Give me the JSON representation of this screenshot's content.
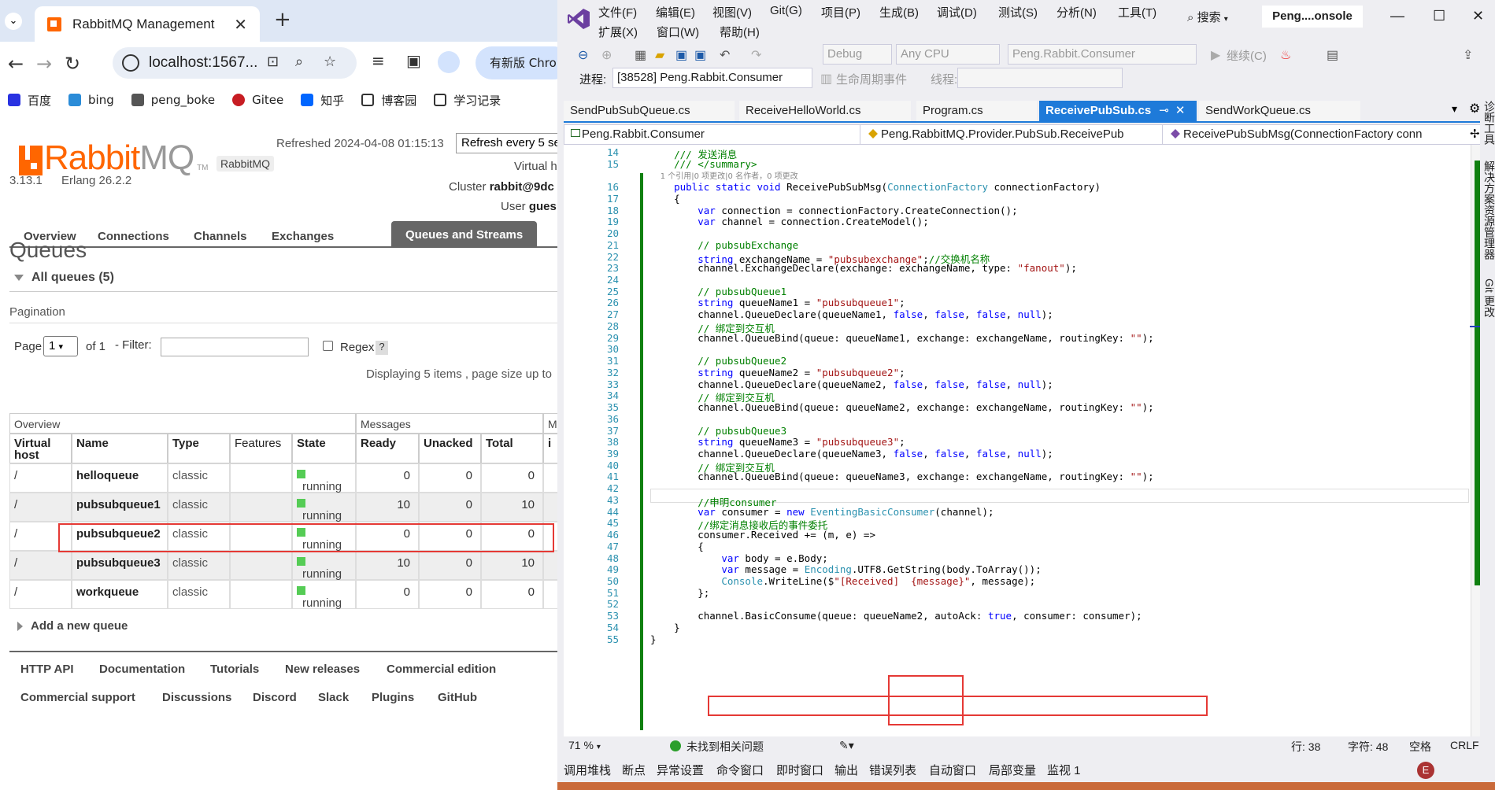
{
  "browser": {
    "tab_title": "RabbitMQ Management",
    "url": "localhost:1567...",
    "update_button": "有新版 Chro",
    "bookmarks": [
      "百度",
      "bing",
      "peng_boke",
      "Gitee",
      "知乎",
      "博客园",
      "学习记录"
    ]
  },
  "rabbitmq": {
    "logo_rabbit": "Rabbit",
    "logo_mq": "MQ",
    "logo_tm": "TM",
    "version": "3.13.1",
    "erlang": "Erlang 26.2.2",
    "cluster_badge": "RabbitMQ",
    "refreshed": "Refreshed 2024-04-08 01:15:13",
    "refresh_select": "Refresh every 5 se",
    "virtual_host": "Virtual h",
    "cluster_prefix": "Cluster ",
    "cluster_name": "rabbit@9dc",
    "user_prefix": "User ",
    "user_name": "gues",
    "nav": [
      "Overview",
      "Connections",
      "Channels",
      "Exchanges",
      "Queues and Streams"
    ],
    "nav_active": "Queues and Streams",
    "page_heading": "Queues",
    "all_queues": "All queues (5)",
    "pagination_label": "Pagination",
    "page_label": "Page",
    "page_value": "1",
    "of_label": "of 1",
    "filter_label": "- Filter:",
    "regex_label": "Regex",
    "regex_help": "?",
    "displaying": "Displaying 5 items , page size up to",
    "table": {
      "group_overview": "Overview",
      "group_messages": "Messages",
      "group_more": "M",
      "headers": [
        "Virtual host",
        "Name",
        "Type",
        "Features",
        "State",
        "Ready",
        "Unacked",
        "Total",
        "i"
      ],
      "rows": [
        {
          "vhost": "/",
          "name": "helloqueue",
          "type": "classic",
          "state": "running",
          "ready": "0",
          "unacked": "0",
          "total": "0"
        },
        {
          "vhost": "/",
          "name": "pubsubqueue1",
          "type": "classic",
          "state": "running",
          "ready": "10",
          "unacked": "0",
          "total": "10"
        },
        {
          "vhost": "/",
          "name": "pubsubqueue2",
          "type": "classic",
          "state": "running",
          "ready": "0",
          "unacked": "0",
          "total": "0"
        },
        {
          "vhost": "/",
          "name": "pubsubqueue3",
          "type": "classic",
          "state": "running",
          "ready": "10",
          "unacked": "0",
          "total": "10"
        },
        {
          "vhost": "/",
          "name": "workqueue",
          "type": "classic",
          "state": "running",
          "ready": "0",
          "unacked": "0",
          "total": "0"
        }
      ],
      "highlighted_row": "pubsubqueue2"
    },
    "add_queue": "Add a new queue",
    "footer": [
      "HTTP API",
      "Documentation",
      "Tutorials",
      "New releases",
      "Commercial edition",
      "Commercial support",
      "Discussions",
      "Discord",
      "Slack",
      "Plugins",
      "GitHub"
    ]
  },
  "vs": {
    "menu": [
      "文件(F)",
      "编辑(E)",
      "视图(V)",
      "Git(G)",
      "项目(P)",
      "生成(B)",
      "调试(D)",
      "测试(S)",
      "分析(N)",
      "工具(T)",
      "扩展(X)",
      "窗口(W)",
      "帮助(H)"
    ],
    "search": "搜索",
    "solution": "Peng....onsole",
    "config": "Debug",
    "platform": "Any CPU",
    "startup_project": "Peng.Rabbit.Consumer",
    "continue": "继续(C)",
    "process_label": "进程:",
    "process": "[38528] Peng.Rabbit.Consumer",
    "lifecycle": "生命周期事件",
    "thread_label": "线程:",
    "tabs": [
      "SendPubSubQueue.cs",
      "ReceiveHelloWorld.cs",
      "Program.cs",
      "ReceivePubSub.cs",
      "SendWorkQueue.cs"
    ],
    "active_tab": "ReceivePubSub.cs",
    "nav_project": "Peng.Rabbit.Consumer",
    "nav_class": "Peng.RabbitMQ.Provider.PubSub.ReceivePub",
    "nav_member": "ReceivePubSubMsg(ConnectionFactory conn",
    "code_lines": [
      {
        "n": "14",
        "t": "    /// 发送消息"
      },
      {
        "n": "15",
        "t": "    /// </summary>"
      },
      {
        "n": "",
        "t": "    1 个引用|0 项更改|0 名作者，0 项更改",
        "lens": true
      },
      {
        "n": "16",
        "t": "    public static void ReceivePubSubMsg(ConnectionFactory connectionFactory)"
      },
      {
        "n": "17",
        "t": "    {"
      },
      {
        "n": "18",
        "t": "        var connection = connectionFactory.CreateConnection();"
      },
      {
        "n": "19",
        "t": "        var channel = connection.CreateModel();"
      },
      {
        "n": "20",
        "t": ""
      },
      {
        "n": "21",
        "t": "        // pubsubExchange"
      },
      {
        "n": "22",
        "t": "        string exchangeName = \"pubsubexchange\";//交换机名称"
      },
      {
        "n": "23",
        "t": "        channel.ExchangeDeclare(exchange: exchangeName, type: \"fanout\");"
      },
      {
        "n": "24",
        "t": ""
      },
      {
        "n": "25",
        "t": "        // pubsubQueue1"
      },
      {
        "n": "26",
        "t": "        string queueName1 = \"pubsubqueue1\";"
      },
      {
        "n": "27",
        "t": "        channel.QueueDeclare(queueName1, false, false, false, null);"
      },
      {
        "n": "28",
        "t": "        // 绑定到交互机"
      },
      {
        "n": "29",
        "t": "        channel.QueueBind(queue: queueName1, exchange: exchangeName, routingKey: \"\");"
      },
      {
        "n": "30",
        "t": ""
      },
      {
        "n": "31",
        "t": "        // pubsubQueue2"
      },
      {
        "n": "32",
        "t": "        string queueName2 = \"pubsubqueue2\";"
      },
      {
        "n": "33",
        "t": "        channel.QueueDeclare(queueName2, false, false, false, null);"
      },
      {
        "n": "34",
        "t": "        // 绑定到交互机"
      },
      {
        "n": "35",
        "t": "        channel.QueueBind(queue: queueName2, exchange: exchangeName, routingKey: \"\");"
      },
      {
        "n": "36",
        "t": ""
      },
      {
        "n": "37",
        "t": "        // pubsubQueue3"
      },
      {
        "n": "38",
        "t": "        string queueName3 = \"pubsubqueue3\";"
      },
      {
        "n": "39",
        "t": "        channel.QueueDeclare(queueName3, false, false, false, null);"
      },
      {
        "n": "40",
        "t": "        // 绑定到交互机"
      },
      {
        "n": "41",
        "t": "        channel.QueueBind(queue: queueName3, exchange: exchangeName, routingKey: \"\");"
      },
      {
        "n": "42",
        "t": ""
      },
      {
        "n": "43",
        "t": "        //申明consumer"
      },
      {
        "n": "44",
        "t": "        var consumer = new EventingBasicConsumer(channel);"
      },
      {
        "n": "45",
        "t": "        //绑定消息接收后的事件委托"
      },
      {
        "n": "46",
        "t": "        consumer.Received += (m, e) =>"
      },
      {
        "n": "47",
        "t": "        {"
      },
      {
        "n": "48",
        "t": "            var body = e.Body;"
      },
      {
        "n": "49",
        "t": "            var message = Encoding.UTF8.GetString(body.ToArray());"
      },
      {
        "n": "50",
        "t": "            Console.WriteLine($\"[Received]  {message}\", message);"
      },
      {
        "n": "51",
        "t": "        };"
      },
      {
        "n": "52",
        "t": ""
      },
      {
        "n": "53",
        "t": "        channel.BasicConsume(queue: queueName2, autoAck: true, consumer: consumer);"
      },
      {
        "n": "54",
        "t": "    }"
      },
      {
        "n": "55",
        "t": "}"
      }
    ],
    "zoom": "71 %",
    "issues": "未找到相关问题",
    "line": "行: 38",
    "char": "字符: 48",
    "space": "空格",
    "eol": "CRLF",
    "tool_tabs": [
      "调用堆栈",
      "断点",
      "异常设置",
      "命令窗口",
      "即时窗口",
      "输出",
      "错误列表",
      "自动窗口",
      "局部变量",
      "监视 1"
    ],
    "rail": [
      "诊断工具",
      "解决方案资源管理器",
      "Git 更改"
    ]
  }
}
